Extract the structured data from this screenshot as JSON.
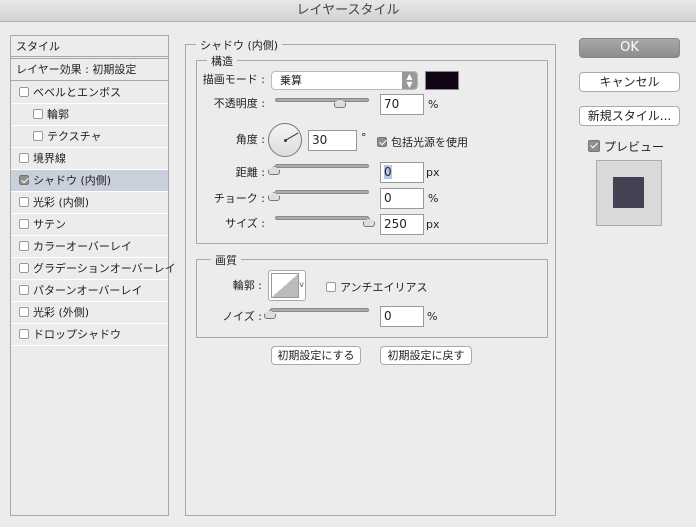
{
  "window": {
    "title": "レイヤースタイル"
  },
  "sidebar": {
    "header": "スタイル",
    "blending": "レイヤー効果 : 初期設定",
    "items": [
      {
        "label": "ベベルとエンボス",
        "checked": false
      },
      {
        "label": "輪郭",
        "checked": false
      },
      {
        "label": "テクスチャ",
        "checked": false
      },
      {
        "label": "境界線",
        "checked": false
      },
      {
        "label": "シャドウ (内側)",
        "checked": true,
        "selected": true
      },
      {
        "label": "光彩 (内側)",
        "checked": false
      },
      {
        "label": "サテン",
        "checked": false
      },
      {
        "label": "カラーオーバーレイ",
        "checked": false
      },
      {
        "label": "グラデーションオーバーレイ",
        "checked": false
      },
      {
        "label": "パターンオーバーレイ",
        "checked": false
      },
      {
        "label": "光彩 (外側)",
        "checked": false
      },
      {
        "label": "ドロップシャドウ",
        "checked": false
      }
    ]
  },
  "panel": {
    "title": "シャドウ (内側)",
    "structure": {
      "title": "構造",
      "blend_mode_label": "描画モード :",
      "blend_mode": "乗算",
      "color": "#120516",
      "opacity_label": "不透明度 :",
      "opacity": "70",
      "opacity_unit": "%",
      "angle_label": "角度 :",
      "angle": "30",
      "angle_unit": "°",
      "global_light_label": "包括光源を使用",
      "global_light": true,
      "distance_label": "距離 :",
      "distance": "0",
      "distance_unit": "px",
      "choke_label": "チョーク :",
      "choke": "0",
      "choke_unit": "%",
      "size_label": "サイズ :",
      "size": "250",
      "size_unit": "px"
    },
    "quality": {
      "title": "画質",
      "contour_label": "輪郭 :",
      "antialias_label": "アンチエイリアス",
      "antialias": false,
      "noise_label": "ノイズ :",
      "noise": "0",
      "noise_unit": "%"
    },
    "make_default": "初期設定にする",
    "reset_default": "初期設定に戻す"
  },
  "actions": {
    "ok": "OK",
    "cancel": "キャンセル",
    "new_style": "新規スタイル...",
    "preview_label": "プレビュー",
    "preview": true,
    "preview_color": "#424253"
  }
}
